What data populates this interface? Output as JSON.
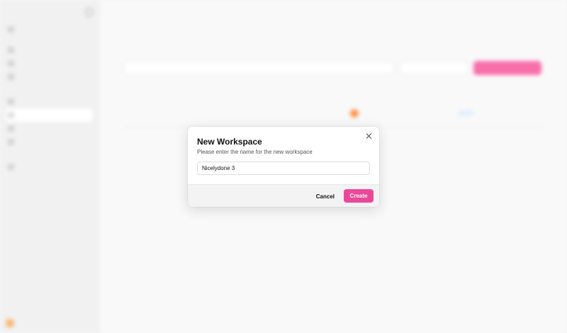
{
  "dialog": {
    "title": "New Workspace",
    "description": "Please enter the name for the new workspace",
    "input_value": "Nicelydone 3",
    "cancel_label": "Cancel",
    "create_label": "Create"
  },
  "colors": {
    "accent": "#ec4899"
  },
  "icons": {
    "close": "close-icon"
  }
}
